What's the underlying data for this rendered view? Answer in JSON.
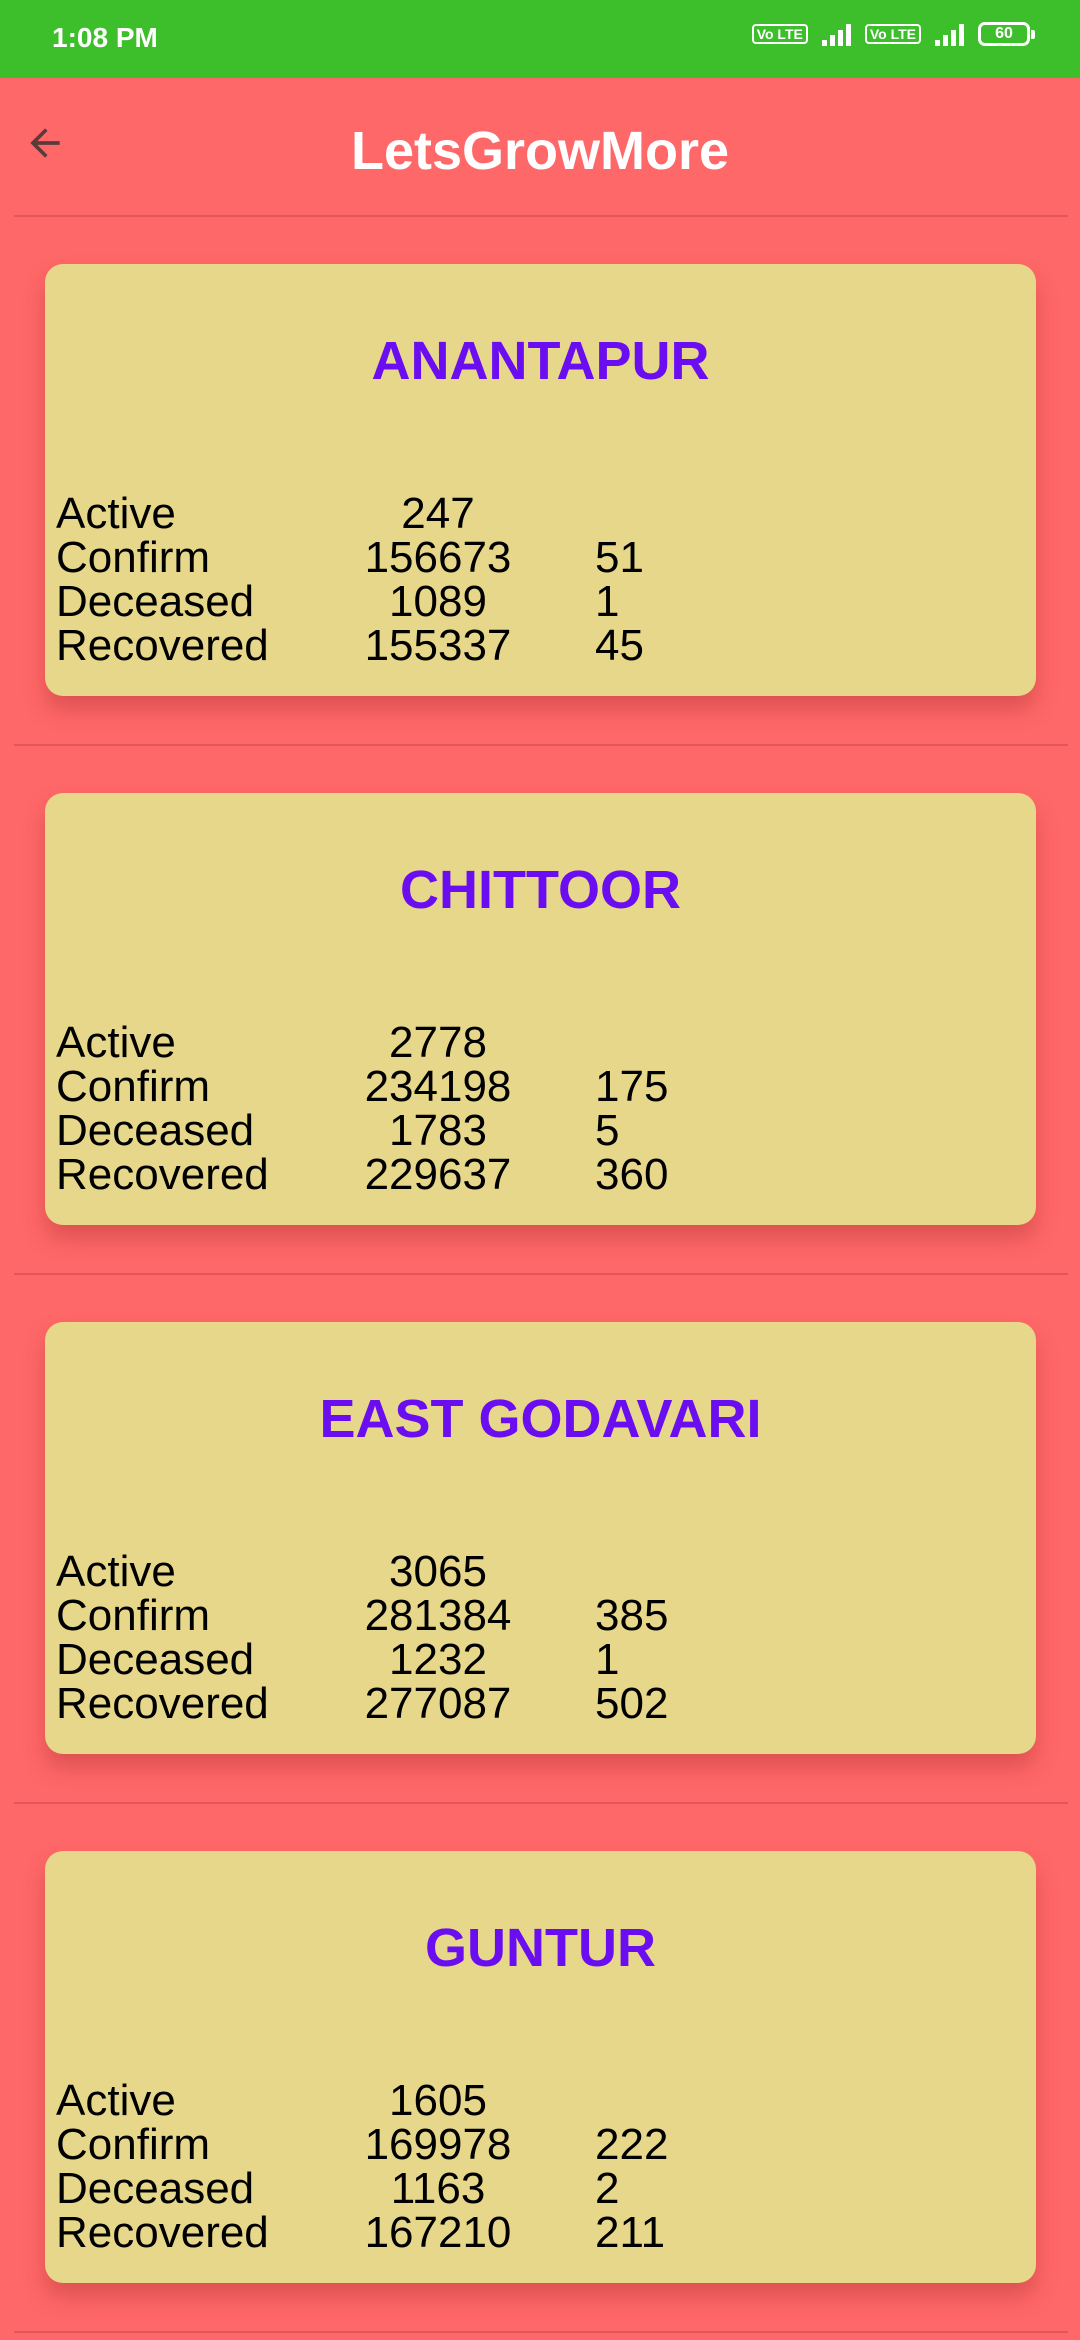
{
  "status_bar": {
    "time": "1:08 PM",
    "sim1_label": "Vo LTE",
    "sim2_label": "Vo LTE",
    "battery": "60"
  },
  "app_bar": {
    "title": "LetsGrowMore",
    "back_icon": "arrow-back-icon"
  },
  "colors": {
    "background": "#ff6868",
    "status_bar": "#3dbf2b",
    "card": "#e6d78a",
    "district_title": "#6a0df0"
  },
  "districts": [
    {
      "name": "ANANTAPUR",
      "rows": [
        {
          "label": "Active",
          "value": "247",
          "delta": ""
        },
        {
          "label": "Confirm",
          "value": "156673",
          "delta": "51"
        },
        {
          "label": "Deceased",
          "value": "1089",
          "delta": "1"
        },
        {
          "label": "Recovered",
          "value": "155337",
          "delta": "45"
        }
      ]
    },
    {
      "name": "CHITTOOR",
      "rows": [
        {
          "label": "Active",
          "value": "2778",
          "delta": ""
        },
        {
          "label": "Confirm",
          "value": "234198",
          "delta": "175"
        },
        {
          "label": "Deceased",
          "value": "1783",
          "delta": "5"
        },
        {
          "label": "Recovered",
          "value": "229637",
          "delta": "360"
        }
      ]
    },
    {
      "name": "EAST GODAVARI",
      "rows": [
        {
          "label": "Active",
          "value": "3065",
          "delta": ""
        },
        {
          "label": "Confirm",
          "value": "281384",
          "delta": "385"
        },
        {
          "label": "Deceased",
          "value": "1232",
          "delta": "1"
        },
        {
          "label": "Recovered",
          "value": "277087",
          "delta": "502"
        }
      ]
    },
    {
      "name": "GUNTUR",
      "rows": [
        {
          "label": "Active",
          "value": "1605",
          "delta": ""
        },
        {
          "label": "Confirm",
          "value": "169978",
          "delta": "222"
        },
        {
          "label": "Deceased",
          "value": "1163",
          "delta": "2"
        },
        {
          "label": "Recovered",
          "value": "167210",
          "delta": "211"
        }
      ]
    }
  ]
}
